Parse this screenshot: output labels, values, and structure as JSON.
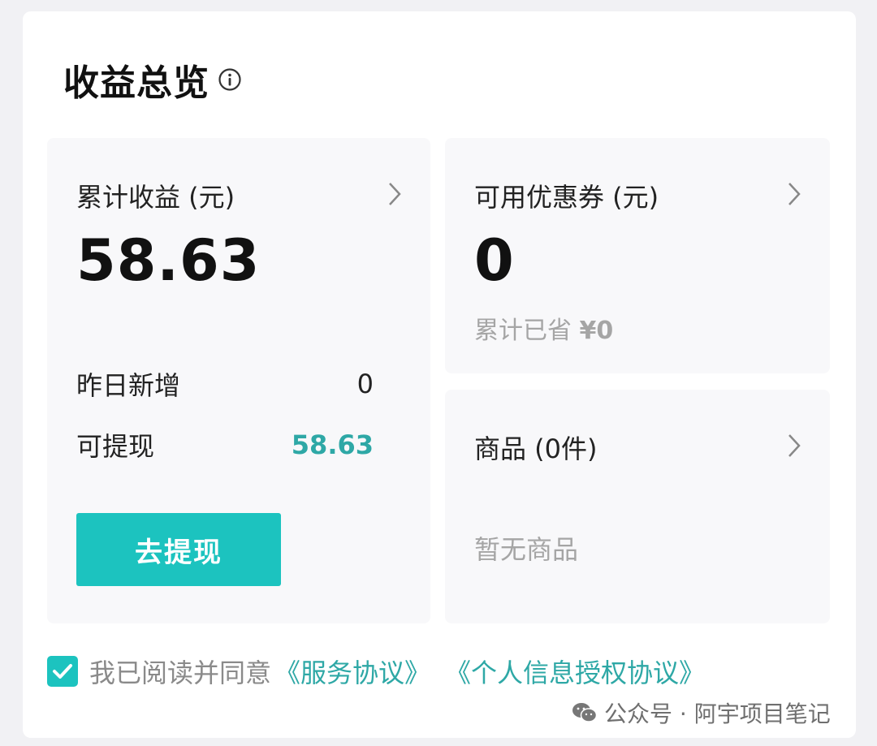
{
  "header": {
    "title": "收益总览",
    "info_icon": "info-circle-icon"
  },
  "earnings": {
    "label": "累计收益 (元)",
    "total": "58.63",
    "yesterday_label": "昨日新增",
    "yesterday_value": "0",
    "withdrawable_label": "可提现",
    "withdrawable_value": "58.63",
    "withdraw_button": "去提现"
  },
  "coupons": {
    "label": "可用优惠券 (元)",
    "value": "0",
    "saved_label": "累计已省",
    "saved_value": "¥0"
  },
  "goods": {
    "label": "商品 (0件)",
    "empty_text": "暂无商品"
  },
  "agreement": {
    "checked": true,
    "prefix": "我已阅读并同意",
    "link1": "《服务协议》",
    "link2": "《个人信息授权协议》"
  },
  "watermark": {
    "text": "公众号 · 阿宇项目笔记",
    "icon": "wechat-icon"
  },
  "colors": {
    "accent": "#1cc3bf",
    "accent_text": "#2ea8a6",
    "muted": "#a5a5a5"
  }
}
